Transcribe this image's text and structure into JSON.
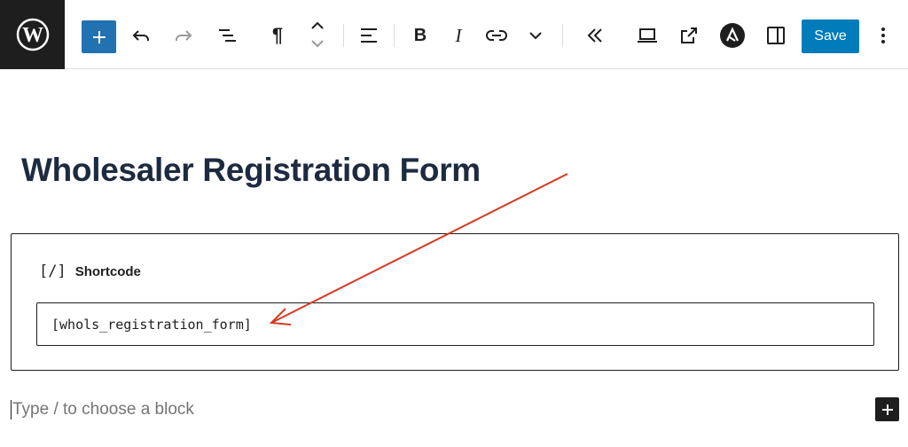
{
  "toolbar": {
    "logo_icon": "wordpress-icon",
    "add_icon": "plus-icon",
    "undo_icon": "undo-icon",
    "redo_icon": "redo-icon",
    "list_view_icon": "list-view-icon",
    "paragraph_icon": "paragraph-icon",
    "move_icon": "move-up-down-icon",
    "align_icon": "align-left-icon",
    "bold_label": "B",
    "italic_label": "I",
    "pilcrow_label": "¶",
    "link_icon": "link-icon",
    "more_icon": "chevron-down-icon",
    "collapse_icon": "chevron-double-left-icon",
    "preview_icon": "laptop-icon",
    "external_icon": "external-link-icon",
    "astra_icon": "astra-icon",
    "settings_icon": "sidebar-icon",
    "save_label": "Save",
    "options_icon": "vertical-ellipsis-icon",
    "accent_color": "#007cba"
  },
  "content": {
    "title": "Wholesaler Registration Form",
    "shortcode_block": {
      "icon_label": "[/]",
      "label": "Shortcode",
      "value": "[whols_registration_form]"
    },
    "appender_placeholder": "Type / to choose a block",
    "annotation_color": "#d63a22"
  }
}
